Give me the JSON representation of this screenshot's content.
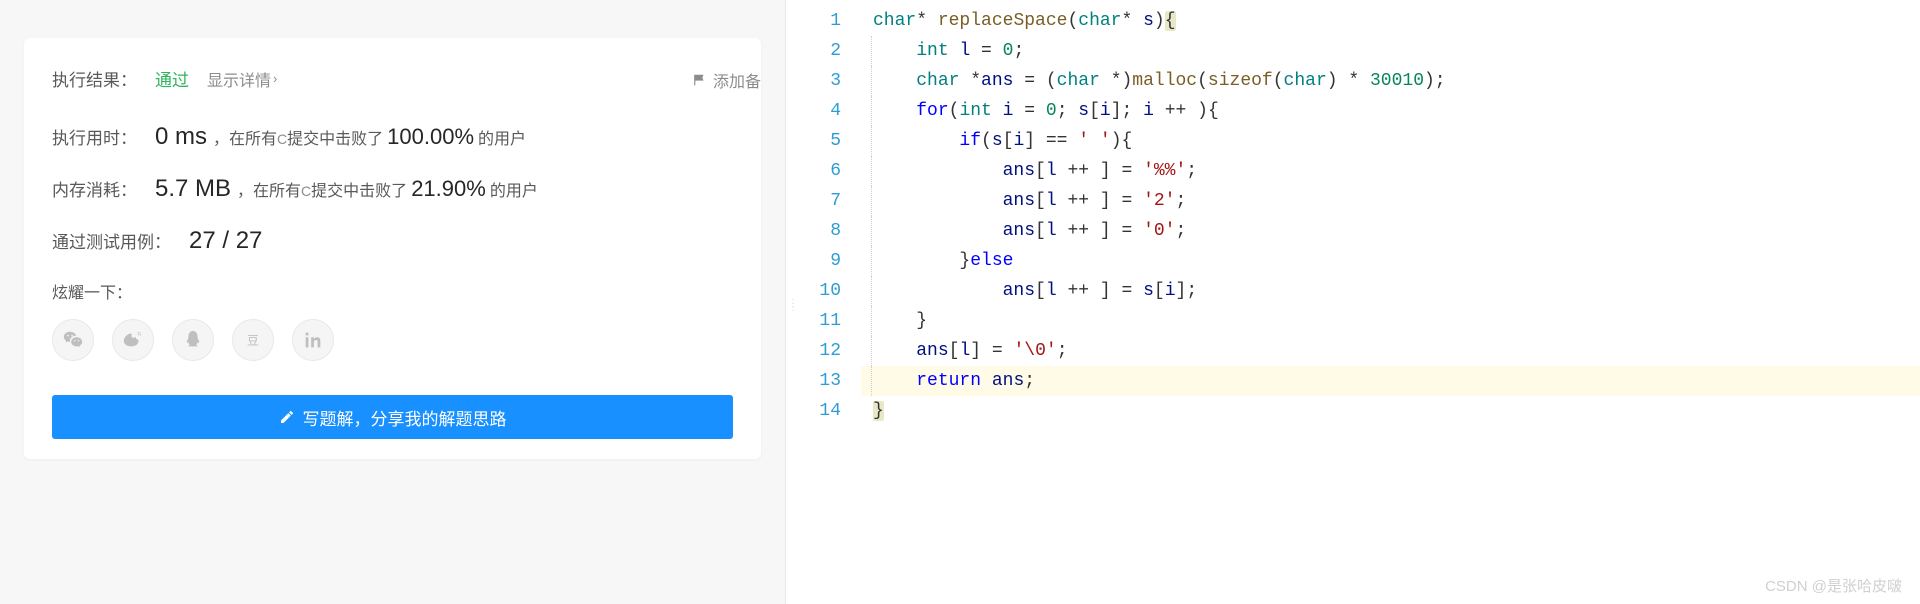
{
  "result": {
    "label": "执行结果：",
    "status": "通过",
    "detail_link": "显示详情",
    "add_note": "添加备"
  },
  "runtime": {
    "label": "执行用时：",
    "value": "0 ms",
    "beats_prefix": "，在所有 ",
    "lang": "C",
    "beats_mid": " 提交中击败了",
    "percent": "100.00%",
    "beats_suffix": "的用户"
  },
  "memory": {
    "label": "内存消耗：",
    "value": "5.7 MB",
    "beats_prefix": "，在所有 ",
    "lang": "C",
    "beats_mid": " 提交中击败了",
    "percent": "21.90%",
    "beats_suffix": "的用户"
  },
  "testcases": {
    "label": "通过测试用例：",
    "value": "27 / 27"
  },
  "share": {
    "label": "炫耀一下：",
    "icons": [
      "wechat",
      "weibo",
      "qq",
      "douban",
      "linkedin"
    ]
  },
  "write_solution": "写题解，分享我的解题思路",
  "watermark": "CSDN @是张哈皮啵",
  "code": {
    "line_count": 14,
    "lines": [
      {
        "n": 1,
        "indent": 0,
        "tokens": [
          [
            "type",
            "char"
          ],
          [
            "op",
            "* "
          ],
          [
            "fn",
            "replaceSpace"
          ],
          [
            "punc",
            "("
          ],
          [
            "type",
            "char"
          ],
          [
            "op",
            "* "
          ],
          [
            "ident",
            "s"
          ],
          [
            "punc",
            ")"
          ],
          [
            "bracehl",
            "{"
          ]
        ]
      },
      {
        "n": 2,
        "indent": 1,
        "tokens": [
          [
            "type",
            "int"
          ],
          [
            "punc",
            " "
          ],
          [
            "ident",
            "l"
          ],
          [
            "punc",
            " = "
          ],
          [
            "num",
            "0"
          ],
          [
            "punc",
            ";"
          ]
        ]
      },
      {
        "n": 3,
        "indent": 1,
        "tokens": [
          [
            "type",
            "char"
          ],
          [
            "punc",
            " *"
          ],
          [
            "ident",
            "ans"
          ],
          [
            "punc",
            " = ("
          ],
          [
            "type",
            "char"
          ],
          [
            "punc",
            " *)"
          ],
          [
            "fn",
            "malloc"
          ],
          [
            "punc",
            "("
          ],
          [
            "fn",
            "sizeof"
          ],
          [
            "punc",
            "("
          ],
          [
            "type",
            "char"
          ],
          [
            "punc",
            ") * "
          ],
          [
            "num",
            "30010"
          ],
          [
            "punc",
            ");"
          ]
        ]
      },
      {
        "n": 4,
        "indent": 1,
        "tokens": [
          [
            "kw",
            "for"
          ],
          [
            "punc",
            "("
          ],
          [
            "type",
            "int"
          ],
          [
            "punc",
            " "
          ],
          [
            "ident",
            "i"
          ],
          [
            "punc",
            " = "
          ],
          [
            "num",
            "0"
          ],
          [
            "punc",
            "; "
          ],
          [
            "ident",
            "s"
          ],
          [
            "punc",
            "["
          ],
          [
            "ident",
            "i"
          ],
          [
            "punc",
            "]; "
          ],
          [
            "ident",
            "i"
          ],
          [
            "punc",
            " ++ ){"
          ]
        ]
      },
      {
        "n": 5,
        "indent": 2,
        "tokens": [
          [
            "kw",
            "if"
          ],
          [
            "punc",
            "("
          ],
          [
            "ident",
            "s"
          ],
          [
            "punc",
            "["
          ],
          [
            "ident",
            "i"
          ],
          [
            "punc",
            "] == "
          ],
          [
            "str",
            "' '"
          ],
          [
            "punc",
            "){"
          ]
        ]
      },
      {
        "n": 6,
        "indent": 3,
        "tokens": [
          [
            "ident",
            "ans"
          ],
          [
            "punc",
            "["
          ],
          [
            "ident",
            "l"
          ],
          [
            "punc",
            " ++ ] = "
          ],
          [
            "str",
            "'%%'"
          ],
          [
            "punc",
            ";"
          ]
        ]
      },
      {
        "n": 7,
        "indent": 3,
        "tokens": [
          [
            "ident",
            "ans"
          ],
          [
            "punc",
            "["
          ],
          [
            "ident",
            "l"
          ],
          [
            "punc",
            " ++ ] = "
          ],
          [
            "str",
            "'2'"
          ],
          [
            "punc",
            ";"
          ]
        ]
      },
      {
        "n": 8,
        "indent": 3,
        "tokens": [
          [
            "ident",
            "ans"
          ],
          [
            "punc",
            "["
          ],
          [
            "ident",
            "l"
          ],
          [
            "punc",
            " ++ ] = "
          ],
          [
            "str",
            "'0'"
          ],
          [
            "punc",
            ";"
          ]
        ]
      },
      {
        "n": 9,
        "indent": 2,
        "tokens": [
          [
            "punc",
            "}"
          ],
          [
            "kw",
            "else"
          ]
        ]
      },
      {
        "n": 10,
        "indent": 3,
        "tokens": [
          [
            "ident",
            "ans"
          ],
          [
            "punc",
            "["
          ],
          [
            "ident",
            "l"
          ],
          [
            "punc",
            " ++ ] = "
          ],
          [
            "ident",
            "s"
          ],
          [
            "punc",
            "["
          ],
          [
            "ident",
            "i"
          ],
          [
            "punc",
            "];"
          ]
        ]
      },
      {
        "n": 11,
        "indent": 1,
        "tokens": [
          [
            "punc",
            "}"
          ]
        ]
      },
      {
        "n": 12,
        "indent": 1,
        "tokens": [
          [
            "ident",
            "ans"
          ],
          [
            "punc",
            "["
          ],
          [
            "ident",
            "l"
          ],
          [
            "punc",
            "] = "
          ],
          [
            "str",
            "'\\0'"
          ],
          [
            "punc",
            ";"
          ]
        ]
      },
      {
        "n": 13,
        "indent": 1,
        "hl": true,
        "tokens": [
          [
            "kw",
            "return"
          ],
          [
            "punc",
            " "
          ],
          [
            "ident",
            "ans"
          ],
          [
            "punc",
            ";"
          ]
        ]
      },
      {
        "n": 14,
        "indent": 0,
        "tokens": [
          [
            "bracehl",
            "}"
          ]
        ]
      }
    ]
  }
}
